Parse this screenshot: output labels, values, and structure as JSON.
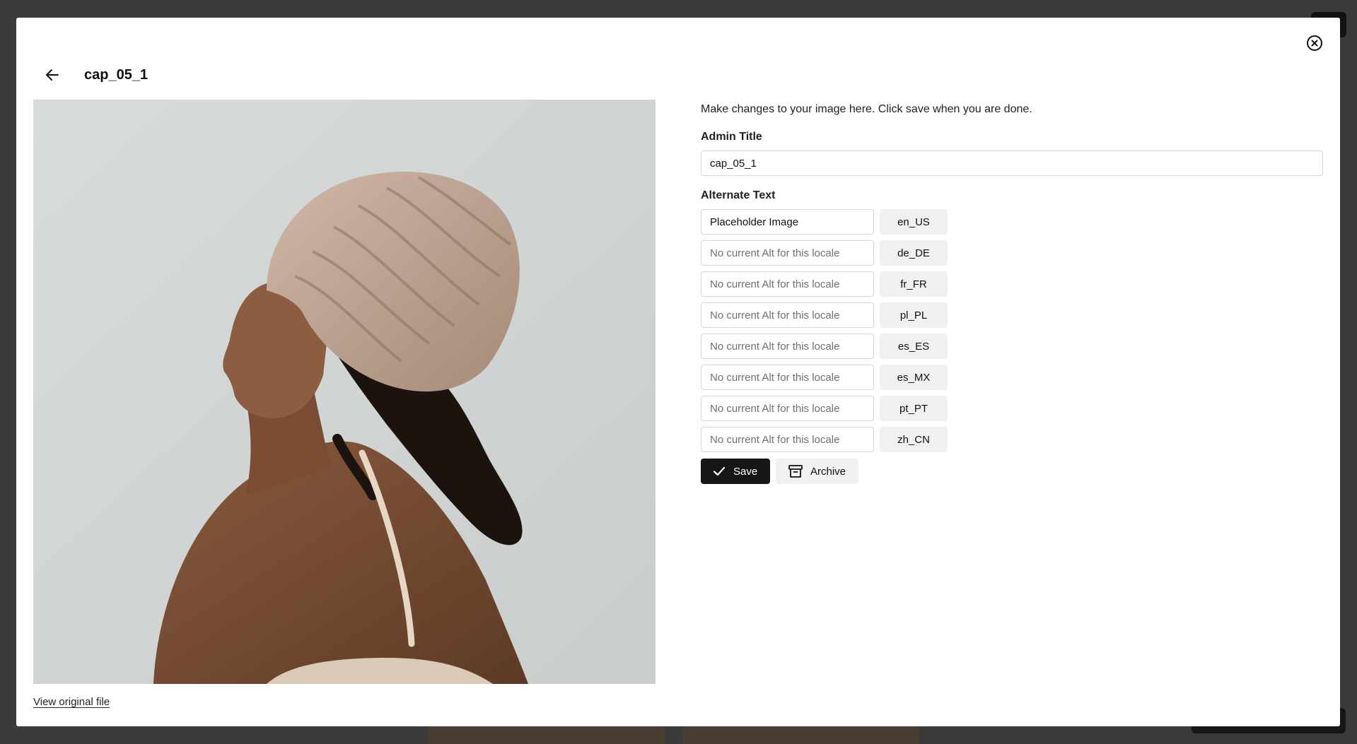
{
  "modal": {
    "title": "cap_05_1",
    "view_original_label": "View original file",
    "preview_alt": "Woman in a beige knitted beanie, side profile"
  },
  "form": {
    "intro": "Make changes to your image here. Click save when you are done.",
    "admin_title_label": "Admin Title",
    "admin_title_value": "cap_05_1",
    "alt_text_label": "Alternate Text",
    "alt_placeholder": "No current Alt for this locale",
    "alt_rows": [
      {
        "value": "Placeholder Image",
        "locale": "en_US"
      },
      {
        "value": "",
        "locale": "de_DE"
      },
      {
        "value": "",
        "locale": "fr_FR"
      },
      {
        "value": "",
        "locale": "pl_PL"
      },
      {
        "value": "",
        "locale": "es_ES"
      },
      {
        "value": "",
        "locale": "es_MX"
      },
      {
        "value": "",
        "locale": "pt_PT"
      },
      {
        "value": "",
        "locale": "zh_CN"
      }
    ],
    "save_label": "Save",
    "archive_label": "Archive"
  },
  "icons": {
    "close": "close-circle-icon",
    "back": "arrow-left-icon",
    "save": "check-icon",
    "archive": "archive-box-icon"
  }
}
